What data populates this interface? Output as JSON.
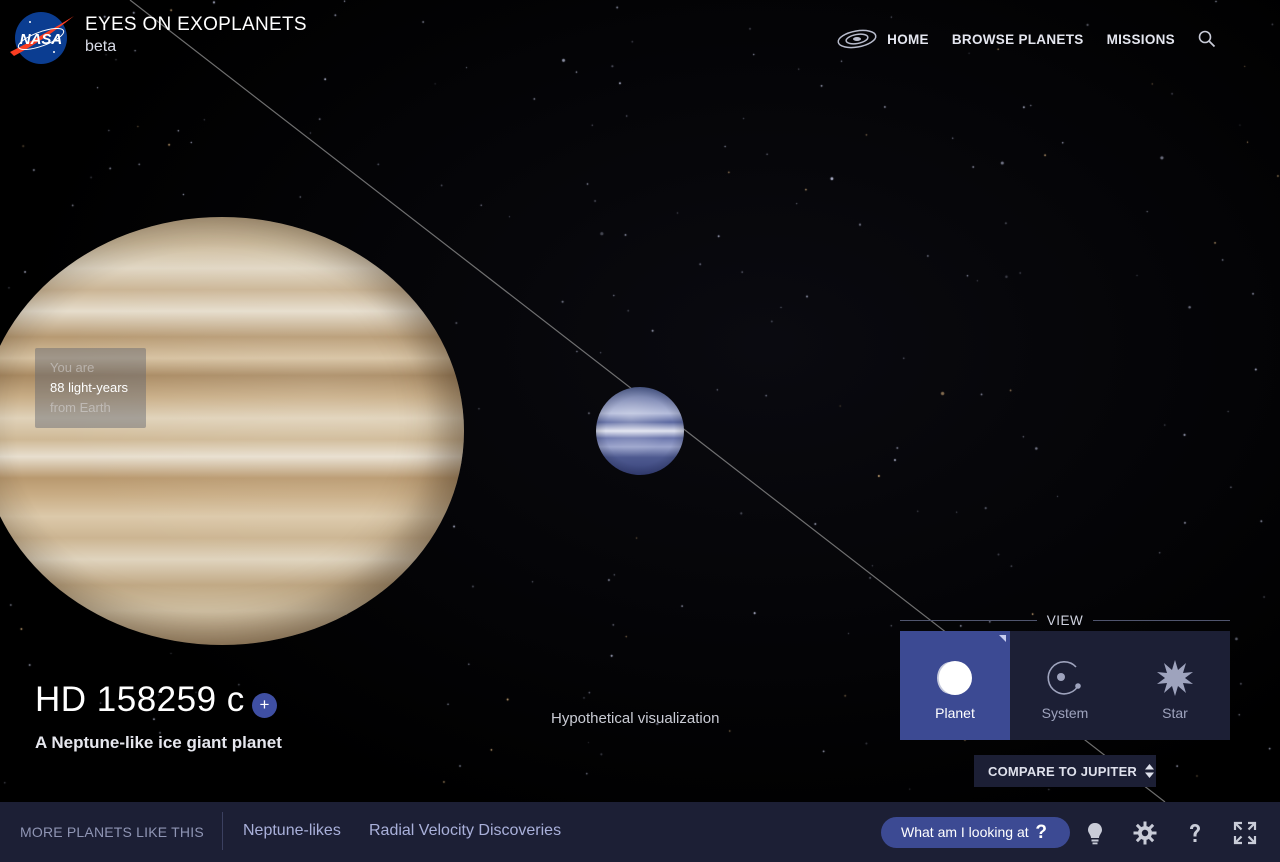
{
  "header": {
    "logo_text": "NASA",
    "title": "EYES ON EXOPLANETS",
    "subtitle": "beta",
    "nav": [
      "HOME",
      "BROWSE PLANETS",
      "MISSIONS"
    ]
  },
  "distance": {
    "line1": "You are",
    "line2": "88 light-years",
    "line3": "from Earth"
  },
  "planet": {
    "name": "HD 158259 c",
    "add_symbol": "+",
    "description": "A Neptune-like ice giant planet"
  },
  "visualization_note": "Hypothetical visualization",
  "view": {
    "label": "VIEW",
    "options": [
      {
        "label": "Planet",
        "icon": "planet-icon",
        "active": true
      },
      {
        "label": "System",
        "icon": "system-icon",
        "active": false
      },
      {
        "label": "Star",
        "icon": "star-icon",
        "active": false
      }
    ]
  },
  "compare": {
    "label": "COMPARE TO JUPITER"
  },
  "bottom_bar": {
    "more_label": "MORE PLANETS LIKE THIS",
    "links": [
      "Neptune-likes",
      "Radial Velocity Discoveries"
    ],
    "help_button": "What am I looking at",
    "help_symbol": "?",
    "icons": [
      "lightbulb-icon",
      "gear-icon",
      "help-icon",
      "fullscreen-icon"
    ]
  },
  "colors": {
    "panel_bg": "#1c1f35",
    "accent": "#3c4a93",
    "nasa_blue": "#0b3d91",
    "nasa_red": "#fc3d21"
  }
}
